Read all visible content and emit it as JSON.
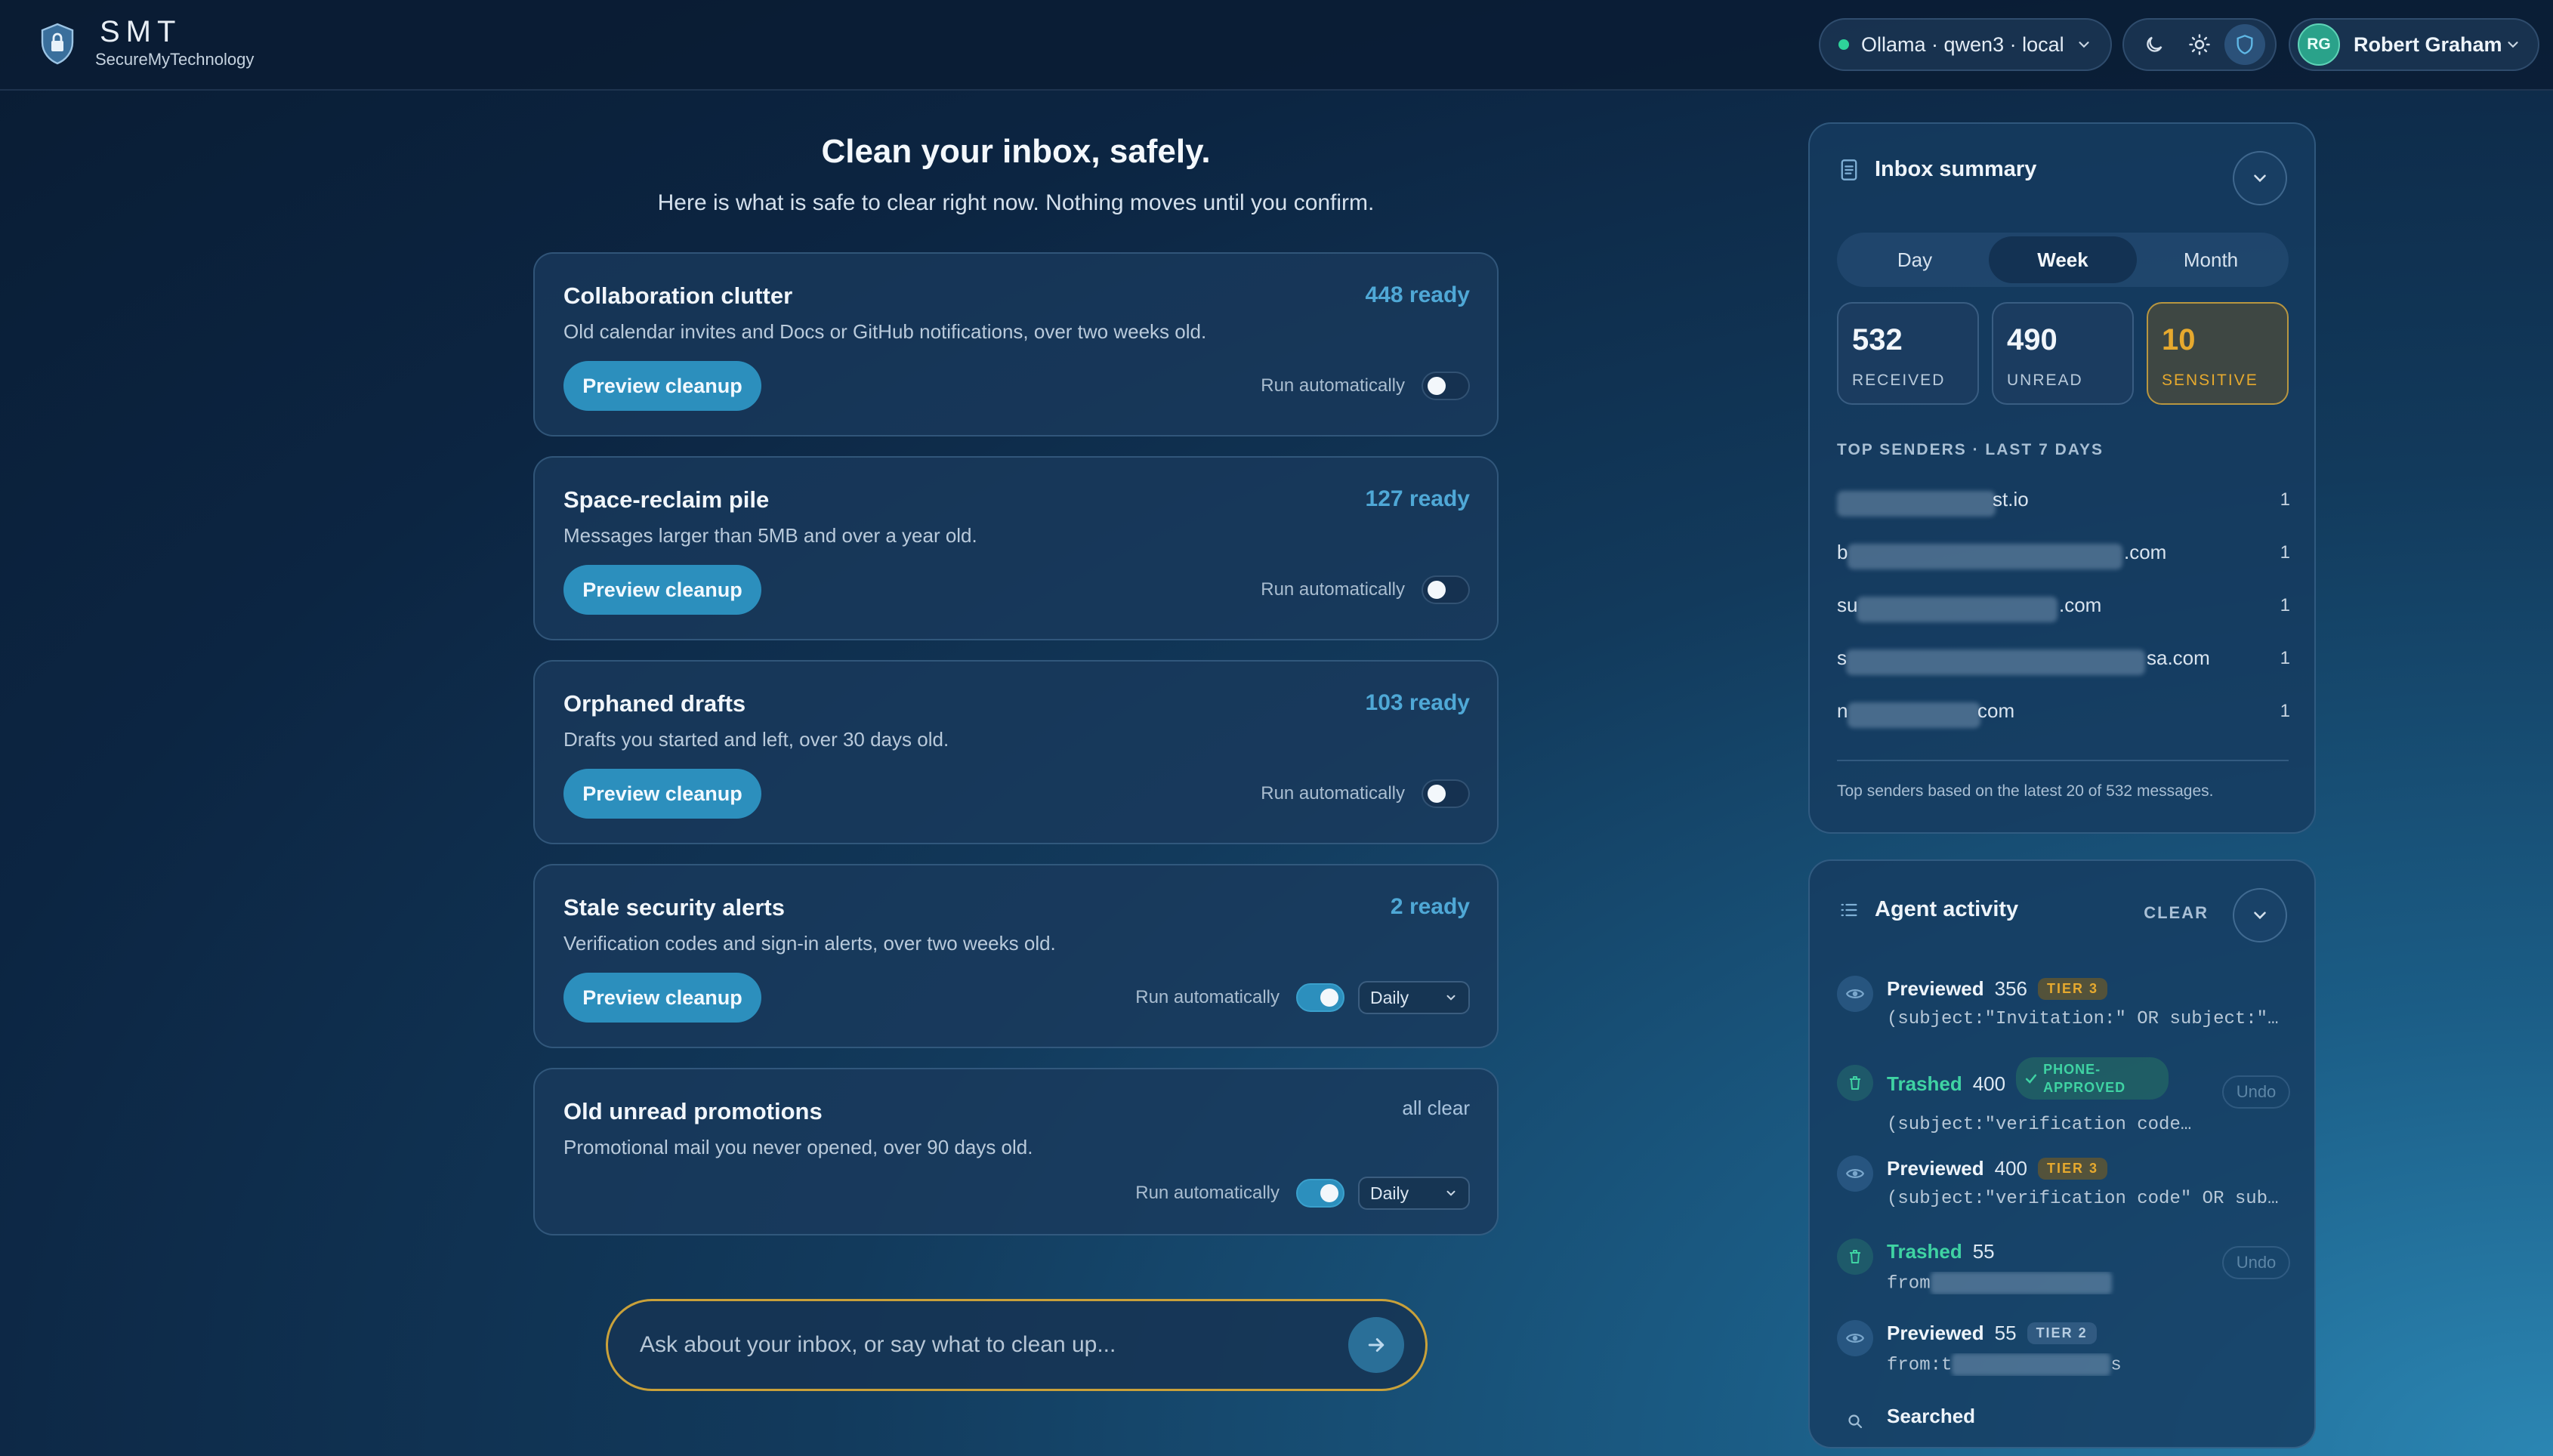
{
  "brand": {
    "name": "SMT",
    "tagline": "SecureMyTechnology"
  },
  "header": {
    "model": "Ollama · qwen3 · local",
    "user": {
      "initials": "RG",
      "name": "Robert Graham"
    }
  },
  "hero": {
    "title": "Clean your inbox, safely.",
    "subtitle": "Here is what is safe to clear right now. Nothing moves until you confirm."
  },
  "cards": [
    {
      "title": "Collaboration clutter",
      "desc": "Old calendar invites and Docs or GitHub notifications, over two weeks old.",
      "count": "448 ready",
      "button": "Preview cleanup",
      "auto_label": "Run automatically",
      "auto": false
    },
    {
      "title": "Space-reclaim pile",
      "desc": "Messages larger than 5MB and over a year old.",
      "count": "127 ready",
      "button": "Preview cleanup",
      "auto_label": "Run automatically",
      "auto": false
    },
    {
      "title": "Orphaned drafts",
      "desc": "Drafts you started and left, over 30 days old.",
      "count": "103 ready",
      "button": "Preview cleanup",
      "auto_label": "Run automatically",
      "auto": false
    },
    {
      "title": "Stale security alerts",
      "desc": "Verification codes and sign-in alerts, over two weeks old.",
      "count": "2 ready",
      "button": "Preview cleanup",
      "auto_label": "Run automatically",
      "auto": true,
      "frequency": "Daily"
    },
    {
      "title": "Old unread promotions",
      "desc": "Promotional mail you never opened, over 90 days old.",
      "count": "all clear",
      "auto_label": "Run automatically",
      "auto": true,
      "frequency": "Daily"
    }
  ],
  "ask": {
    "placeholder": "Ask about your inbox, or say what to clean up..."
  },
  "summary": {
    "title": "Inbox summary",
    "periods": [
      "Day",
      "Week",
      "Month"
    ],
    "active_period": "Week",
    "stats": [
      {
        "value": "532",
        "label": "RECEIVED"
      },
      {
        "value": "490",
        "label": "UNREAD"
      },
      {
        "value": "10",
        "label": "SENSITIVE"
      }
    ],
    "top_senders_label": "TOP SENDERS · LAST 7 DAYS",
    "senders": [
      {
        "suffix": "st.io",
        "count": "1"
      },
      {
        "prefix": "b",
        "suffix": ".com",
        "count": "1"
      },
      {
        "prefix": "su",
        "suffix": ".com",
        "count": "1"
      },
      {
        "prefix": "s",
        "suffix": "sa.com",
        "count": "1"
      },
      {
        "prefix": "n",
        "suffix": "com",
        "count": "1"
      }
    ],
    "footnote": "Top senders based on the latest 20 of 532 messages."
  },
  "activity": {
    "title": "Agent activity",
    "clear_label": "CLEAR",
    "undo_label": "Undo",
    "items": [
      {
        "verb": "Previewed",
        "n": "356",
        "tier": "TIER 3",
        "query": "(subject:\"Invitation:\" OR subject:\"…"
      },
      {
        "verb": "Trashed",
        "n": "400",
        "badge": "PHONE-APPROVED",
        "query": "(subject:\"verification code…"
      },
      {
        "verb": "Previewed",
        "n": "400",
        "tier": "TIER 3",
        "query": "(subject:\"verification code\" OR sub…"
      },
      {
        "verb": "Trashed",
        "n": "55",
        "query": "from"
      },
      {
        "verb": "Previewed",
        "n": "55",
        "tier": "TIER 2",
        "query": "from:t",
        "query_end": "s"
      },
      {
        "verb": "Searched"
      }
    ]
  },
  "colors": {
    "accent": "#2c8fbd",
    "warning": "#e6a92e",
    "success": "#3fd3a3",
    "ask_border": "#c9a13a"
  }
}
